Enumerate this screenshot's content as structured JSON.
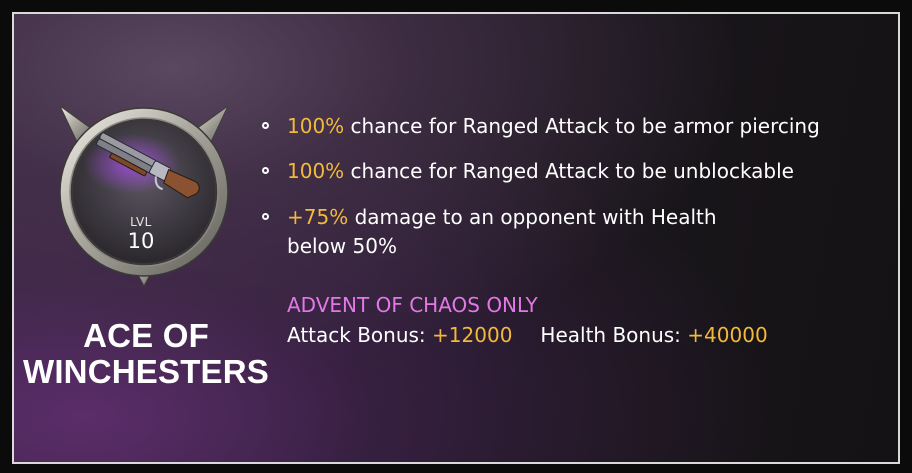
{
  "card": {
    "title_line1": "ACE OF",
    "title_line2": "WINCHESTERS",
    "level_label": "LVL",
    "level_value": "10",
    "item_icon": "sawed-off-shotgun-icon",
    "medal_icon": "silver-medal-frame-icon"
  },
  "perks": [
    {
      "highlight": "100%",
      "text": " chance for Ranged Attack to be armor piercing"
    },
    {
      "highlight": "100%",
      "text": " chance for Ranged Attack to be unblockable"
    },
    {
      "highlight": "+75%",
      "text": " damage to an opponent with Health",
      "text_line2": "below 50%"
    }
  ],
  "event": {
    "label": "ADVENT OF CHAOS ONLY",
    "attack_label": "Attack Bonus: ",
    "attack_value": "+12000",
    "health_label": "Health Bonus: ",
    "health_value": "+40000"
  },
  "colors": {
    "highlight": "#f2b93b",
    "event_label": "#e278e6",
    "text": "#ffffff",
    "border": "#d9d9d9"
  }
}
